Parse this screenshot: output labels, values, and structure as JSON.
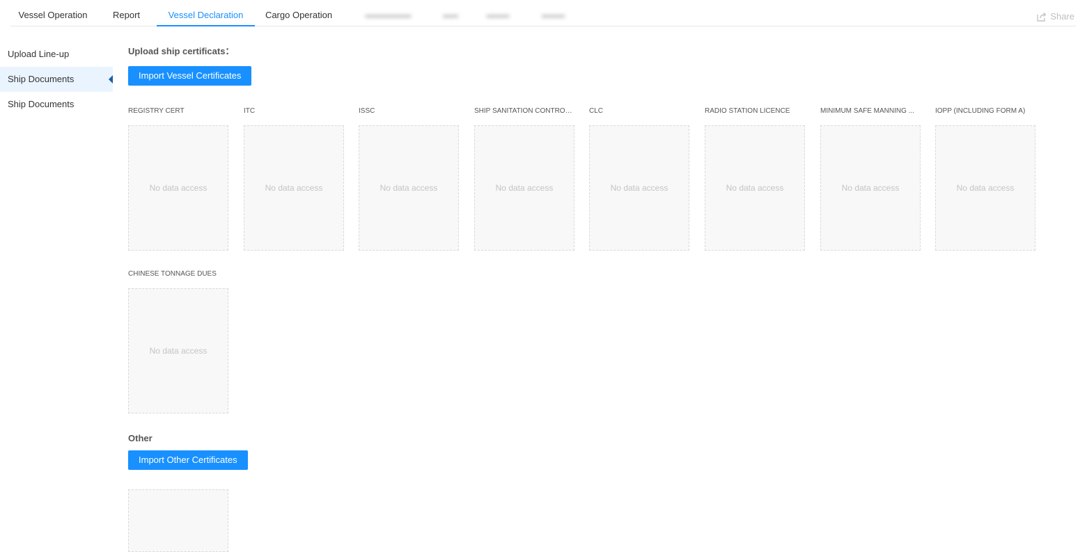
{
  "tabs": [
    {
      "label": "Vessel Operation",
      "active": false
    },
    {
      "label": "Report",
      "active": false
    },
    {
      "label": "Vessel Declaration",
      "active": true
    },
    {
      "label": "Cargo Operation",
      "active": false
    }
  ],
  "share": {
    "label": "Share",
    "icon": "share-icon"
  },
  "sidebar": {
    "items": [
      {
        "label": "Upload Line-up",
        "active": false
      },
      {
        "label": "Ship Documents",
        "active": true
      },
      {
        "label": "Ship Documents",
        "active": false
      }
    ]
  },
  "upload_section": {
    "title": "Upload ship certificats：",
    "button_label": "Import Vessel Certificates",
    "certificates": [
      {
        "label": "REGISTRY CERT",
        "status": "No data access"
      },
      {
        "label": "ITC",
        "status": "No data access"
      },
      {
        "label": "ISSC",
        "status": "No data access"
      },
      {
        "label": "SHIP SANITATION CONTROL...",
        "status": "No data access"
      },
      {
        "label": "CLC",
        "status": "No data access"
      },
      {
        "label": "RADIO STATION LICENCE",
        "status": "No data access"
      },
      {
        "label": "MINIMUM SAFE MANNING ...",
        "status": "No data access"
      },
      {
        "label": "IOPP (INCLUDING FORM A)",
        "status": "No data access"
      },
      {
        "label": "CHINESE TONNAGE DUES",
        "status": "No data access"
      }
    ]
  },
  "other_section": {
    "title": "Other",
    "button_label": "Import Other Certificates"
  },
  "colors": {
    "accent": "#1890ff",
    "sidebar_active_bg": "#eaf4ff",
    "placeholder_bg": "#f8f8f8"
  }
}
